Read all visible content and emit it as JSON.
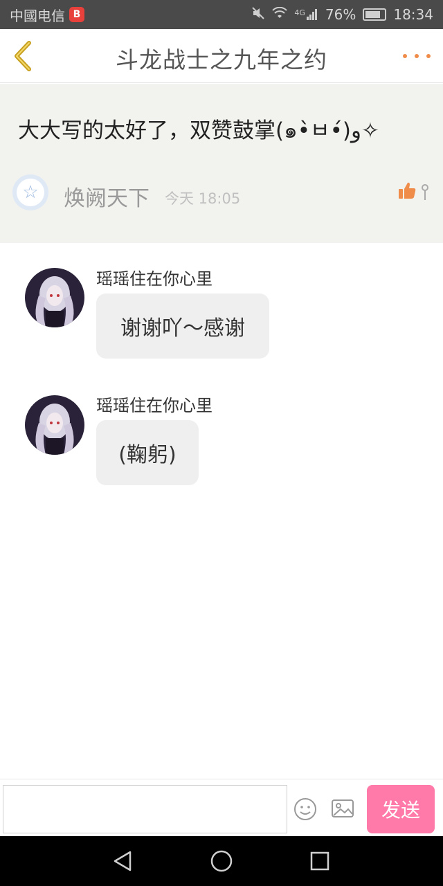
{
  "status_bar": {
    "carrier": "中國电信",
    "carrier_badge": "B",
    "network": "4G",
    "battery": "76%",
    "time": "18:34"
  },
  "header": {
    "title": "斗龙战士之九年之约"
  },
  "comment": {
    "text": "大大写的太好了，双赞鼓掌(๑•̀ㅂ•́)و✧",
    "author": "焕阙天下",
    "time": "今天 18:05"
  },
  "replies": [
    {
      "name": "瑶瑶住在你心里",
      "message": "谢谢吖～感谢"
    },
    {
      "name": "瑶瑶住在你心里",
      "message": "(鞠躬)"
    }
  ],
  "input_bar": {
    "placeholder": "",
    "send_label": "发送"
  },
  "colors": {
    "accent": "#ff7aa8",
    "back_arrow": "#c8a020",
    "like": "#f08c4a"
  }
}
